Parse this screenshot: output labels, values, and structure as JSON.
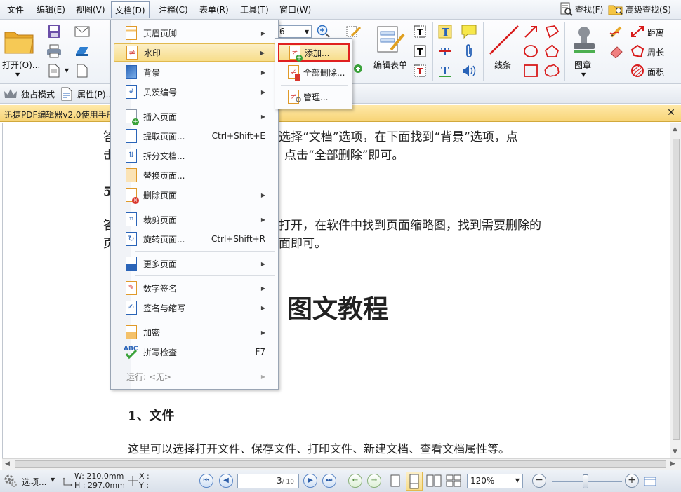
{
  "menubar": {
    "items": [
      "文件",
      "编辑(E)",
      "视图(V)",
      "文档(D)",
      "注释(C)",
      "表单(R)",
      "工具(T)",
      "窗口(W)"
    ],
    "search": "查找(F)",
    "advanced_search": "高级查找(S)"
  },
  "ribbon": {
    "open": "打开(O)...",
    "zoom_value": "6",
    "edit_form": "编辑表单",
    "lines": "线条",
    "stamp": "图章",
    "distance": "距离",
    "perimeter": "周长",
    "area": "面积"
  },
  "subbar": {
    "exclusive_mode": "独占模式",
    "properties": "属性(P)..."
  },
  "doc_tab": {
    "title": "迅捷PDF编辑器v2.0使用手册"
  },
  "document": {
    "line1": "答",
    "line1_rest": "选择“文档”选项，在下面找到“背景”选项，点",
    "line2": "击",
    "line2_rest": "点击“全部删除”即可。",
    "heading5": "5.",
    "line3": "答",
    "line3_rest": "打开，在软件中找到页面缩略图，找到需要删除的",
    "line4": "页",
    "line4_rest": "面即可。",
    "big_title": "图文教程",
    "section1": "1、文件",
    "section1_text": "这里可以选择打开文件、保存文件、打印文件、新建文档、查看文档属性等。"
  },
  "doc_menu": {
    "items": [
      {
        "label": "页眉页脚",
        "shortcut": ""
      },
      {
        "label": "水印",
        "shortcut": ""
      },
      {
        "label": "背景",
        "shortcut": ""
      },
      {
        "label": "贝茨编号",
        "shortcut": ""
      },
      {
        "label": "插入页面",
        "shortcut": ""
      },
      {
        "label": "提取页面...",
        "shortcut": "Ctrl+Shift+E"
      },
      {
        "label": "拆分文档...",
        "shortcut": ""
      },
      {
        "label": "替换页面...",
        "shortcut": ""
      },
      {
        "label": "删除页面",
        "shortcut": ""
      },
      {
        "label": "裁剪页面",
        "shortcut": ""
      },
      {
        "label": "旋转页面...",
        "shortcut": "Ctrl+Shift+R"
      },
      {
        "label": "更多页面",
        "shortcut": ""
      },
      {
        "label": "数字签名",
        "shortcut": ""
      },
      {
        "label": "签名与缩写",
        "shortcut": ""
      },
      {
        "label": "加密",
        "shortcut": ""
      },
      {
        "label": "拼写检查",
        "shortcut": "F7"
      },
      {
        "label": "运行: <无>",
        "shortcut": ""
      }
    ]
  },
  "watermark_submenu": {
    "items": [
      "添加...",
      "全部删除...",
      "管理..."
    ]
  },
  "statusbar": {
    "options": "选项...",
    "width": "W: 210.0mm",
    "height": "H : 297.0mm",
    "x": "X :",
    "y": "Y :",
    "page": "3",
    "page_total": "/ 10",
    "zoom": "120%"
  },
  "colors": {
    "highlight": "#f7dd8a",
    "red_outline": "#e02020",
    "doc_tab": "#f7d477"
  }
}
